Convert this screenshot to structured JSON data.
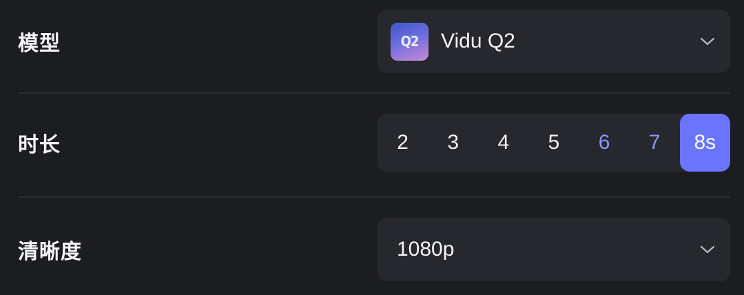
{
  "model": {
    "label": "模型",
    "value": "Vidu Q2",
    "logo_text": "Q2",
    "icon": "chevron-down-icon"
  },
  "duration": {
    "label": "时长",
    "options": [
      "2",
      "3",
      "4",
      "5",
      "6",
      "7",
      "8s"
    ],
    "accent_options": [
      "6",
      "7"
    ],
    "selected": "8s",
    "accent_color": "#8d95ff",
    "selected_color": "#6a74ff"
  },
  "resolution": {
    "label": "清晰度",
    "value": "1080p",
    "icon": "chevron-down-icon"
  },
  "colors": {
    "background": "#1c1d21",
    "control_bg": "#27282d",
    "divider": "#2b2c31"
  }
}
